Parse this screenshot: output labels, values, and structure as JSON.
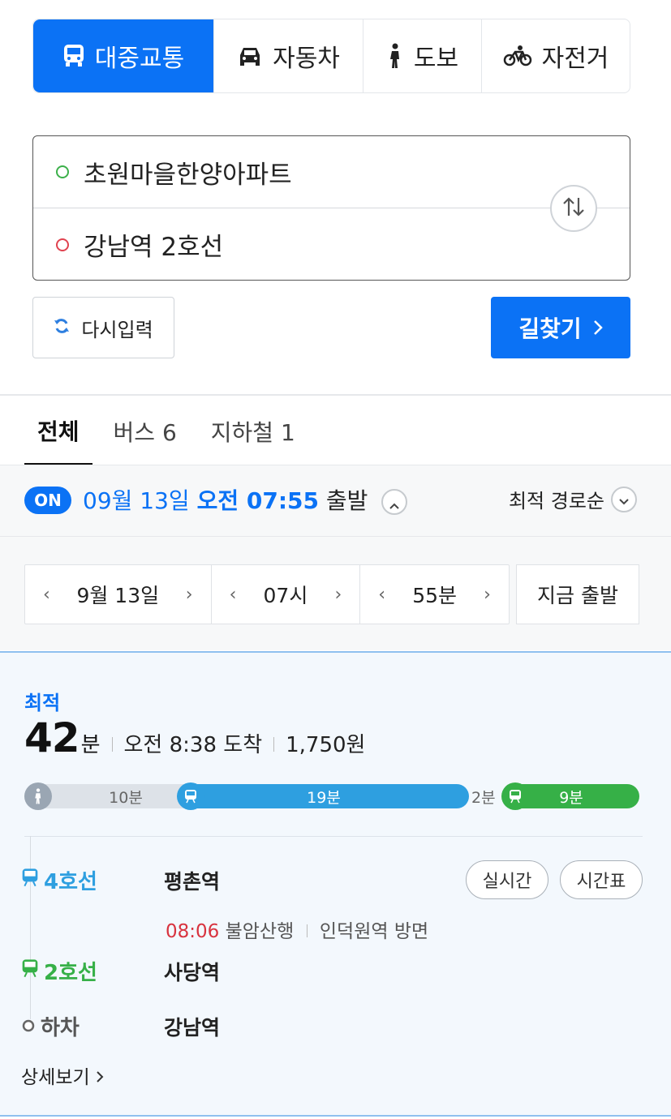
{
  "modes": [
    {
      "label": "대중교통",
      "icon": "bus-icon",
      "active": true
    },
    {
      "label": "자동차",
      "icon": "car-icon",
      "active": false
    },
    {
      "label": "도보",
      "icon": "walk-icon",
      "active": false
    },
    {
      "label": "자전거",
      "icon": "bike-icon",
      "active": false
    }
  ],
  "route": {
    "origin": "초원마을한양아파트",
    "destination": "강남역 2호선"
  },
  "buttons": {
    "reset": "다시입력",
    "search": "길찾기"
  },
  "result_tabs": [
    {
      "label": "전체",
      "active": true
    },
    {
      "label": "버스 6",
      "active": false
    },
    {
      "label": "지하철 1",
      "active": false
    }
  ],
  "departure": {
    "on_badge": "ON",
    "date": "09월 13일",
    "time": "오전 07:55",
    "suffix": "출발",
    "sort": "최적 경로순"
  },
  "pickers": {
    "date": "9월 13일",
    "hour": "07시",
    "minute": "55분",
    "now": "지금 출발"
  },
  "result": {
    "tag": "최적",
    "minutes": "42",
    "minute_unit": "분",
    "arrival": "오전 8:38 도착",
    "fare": "1,750원",
    "segments": [
      {
        "type": "walk",
        "label": "10분"
      },
      {
        "type": "line4",
        "label": "19분"
      },
      {
        "type": "gap",
        "label": "2분"
      },
      {
        "type": "line2",
        "label": "9분"
      }
    ],
    "steps": [
      {
        "line": "4호선",
        "station": "평촌역"
      },
      {
        "line": "2호선",
        "station": "사당역"
      },
      {
        "line": "하차",
        "station": "강남역"
      }
    ],
    "first_detail": {
      "time": "08:06",
      "direction": "불암산행",
      "toward": "인덕원역 방면"
    },
    "realtime_button": "실시간",
    "timetable_button": "시간표",
    "more": "상세보기"
  },
  "colors": {
    "accent": "#0b72f5",
    "line4": "#2e9fe0",
    "line2": "#36b047",
    "origin_dot": "#3cb04a",
    "dest_dot": "#e0424f",
    "time_red": "#d8333f"
  }
}
